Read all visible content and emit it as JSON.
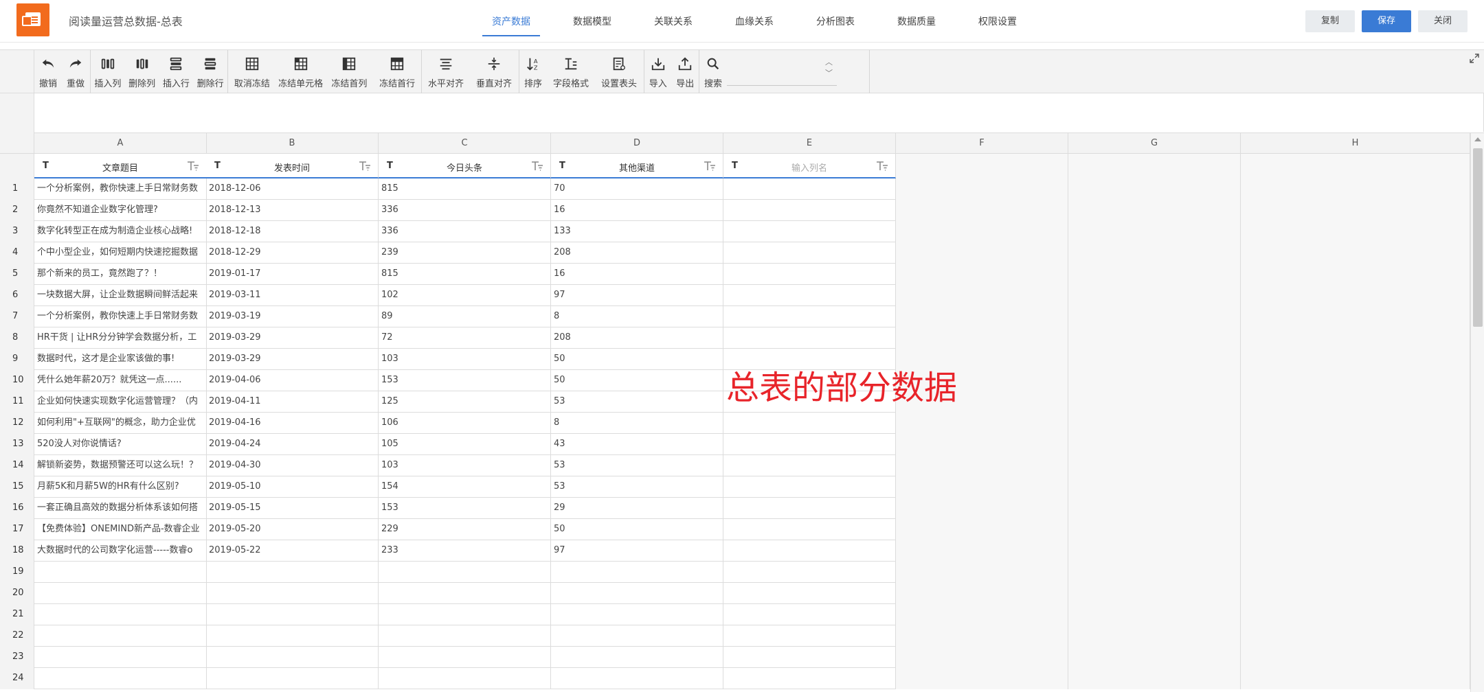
{
  "app": {
    "title": "阅读量运营总数据-总表"
  },
  "tabs": [
    {
      "label": "资产数据",
      "active": true
    },
    {
      "label": "数据模型",
      "active": false
    },
    {
      "label": "关联关系",
      "active": false
    },
    {
      "label": "血缘关系",
      "active": false
    },
    {
      "label": "分析图表",
      "active": false
    },
    {
      "label": "数据质量",
      "active": false
    },
    {
      "label": "权限设置",
      "active": false
    }
  ],
  "buttons": {
    "copy": "复制",
    "save": "保存",
    "close": "关闭"
  },
  "toolbar": {
    "undo": "撤销",
    "redo": "重做",
    "insert_col": "插入列",
    "delete_col": "删除列",
    "insert_row": "插入行",
    "delete_row": "删除行",
    "unfreeze": "取消冻结",
    "freeze_cell": "冻结单元格",
    "freeze_first_col": "冻结首列",
    "freeze_first_row": "冻结首行",
    "h_align": "水平对齐",
    "v_align": "垂直对齐",
    "sort": "排序",
    "field_format": "字段格式",
    "set_header": "设置表头",
    "import": "导入",
    "export": "导出",
    "search": "搜索"
  },
  "columns": [
    "A",
    "B",
    "C",
    "D",
    "E",
    "F",
    "G",
    "H"
  ],
  "fields": [
    {
      "name": "文章题目",
      "type_icon": "T"
    },
    {
      "name": "发表时间",
      "type_icon": "T"
    },
    {
      "name": "今日头条",
      "type_icon": "T"
    },
    {
      "name": "其他渠道",
      "type_icon": "T"
    },
    {
      "placeholder": "输入列名",
      "type_icon": "T"
    }
  ],
  "rows": [
    {
      "n": "1",
      "a": "一个分析案例，教你快速上手日常财务数",
      "b": "2018-12-06",
      "c": "815",
      "d": "70"
    },
    {
      "n": "2",
      "a": "你竟然不知道企业数字化管理?",
      "b": "2018-12-13",
      "c": "336",
      "d": "16"
    },
    {
      "n": "3",
      "a": "数字化转型正在成为制造企业核心战略!",
      "b": "2018-12-18",
      "c": "336",
      "d": "133"
    },
    {
      "n": "4",
      "a": "个中小型企业，如何短期内快速挖掘数据",
      "b": "2018-12-29",
      "c": "239",
      "d": "208"
    },
    {
      "n": "5",
      "a": "那个新来的员工，竟然跑了？！",
      "b": "2019-01-17",
      "c": "815",
      "d": "16"
    },
    {
      "n": "6",
      "a": "一块数据大屏，让企业数据瞬间鲜活起来",
      "b": "2019-03-11",
      "c": "102",
      "d": "97"
    },
    {
      "n": "7",
      "a": "一个分析案例，教你快速上手日常财务数",
      "b": "2019-03-19",
      "c": "89",
      "d": "8"
    },
    {
      "n": "8",
      "a": "HR干货 | 让HR分分钟学会数据分析，工",
      "b": "2019-03-29",
      "c": "72",
      "d": "208"
    },
    {
      "n": "9",
      "a": "数据时代，这才是企业家该做的事!",
      "b": "2019-03-29",
      "c": "103",
      "d": "50"
    },
    {
      "n": "10",
      "a": "凭什么她年薪20万？就凭这一点......",
      "b": "2019-04-06",
      "c": "153",
      "d": "50"
    },
    {
      "n": "11",
      "a": "企业如何快速实现数字化运营管理？（内",
      "b": "2019-04-11",
      "c": "125",
      "d": "53"
    },
    {
      "n": "12",
      "a": "如何利用\"+互联网\"的概念，助力企业优",
      "b": "2019-04-16",
      "c": "106",
      "d": "8"
    },
    {
      "n": "13",
      "a": "520没人对你说情话?",
      "b": "2019-04-24",
      "c": "105",
      "d": "43"
    },
    {
      "n": "14",
      "a": "解锁新姿势，数据预警还可以这么玩！？",
      "b": "2019-04-30",
      "c": "103",
      "d": "53"
    },
    {
      "n": "15",
      "a": "月薪5K和月薪5W的HR有什么区别?",
      "b": "2019-05-10",
      "c": "154",
      "d": "53"
    },
    {
      "n": "16",
      "a": "一套正确且高效的数据分析体系该如何搭",
      "b": "2019-05-15",
      "c": "153",
      "d": "29"
    },
    {
      "n": "17",
      "a": "【免费体验】ONEMIND新产品-数睿企业",
      "b": "2019-05-20",
      "c": "229",
      "d": "50"
    },
    {
      "n": "18",
      "a": "大数据时代的公司数字化运营-----数睿o",
      "b": "2019-05-22",
      "c": "233",
      "d": "97"
    },
    {
      "n": "19",
      "a": "",
      "b": "",
      "c": "",
      "d": ""
    },
    {
      "n": "20",
      "a": "",
      "b": "",
      "c": "",
      "d": ""
    },
    {
      "n": "21",
      "a": "",
      "b": "",
      "c": "",
      "d": ""
    },
    {
      "n": "22",
      "a": "",
      "b": "",
      "c": "",
      "d": ""
    },
    {
      "n": "23",
      "a": "",
      "b": "",
      "c": "",
      "d": ""
    },
    {
      "n": "24",
      "a": "",
      "b": "",
      "c": "",
      "d": ""
    }
  ],
  "annotation": "总表的部分数据",
  "colors": {
    "accent": "#3a7bd5",
    "logo": "#f26b1d",
    "annotation": "#e8242a"
  }
}
